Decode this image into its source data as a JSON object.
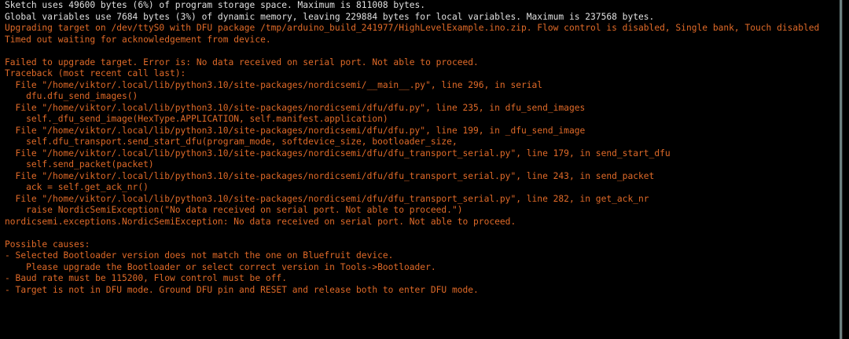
{
  "console": {
    "lines": [
      {
        "text": "Sketch uses 49600 bytes (6%) of program storage space. Maximum is 811008 bytes.",
        "style": "normal"
      },
      {
        "text": "Global variables use 7684 bytes (3%) of dynamic memory, leaving 229884 bytes for local variables. Maximum is 237568 bytes.",
        "style": "normal"
      },
      {
        "text": "Upgrading target on /dev/ttyS0 with DFU package /tmp/arduino_build_241977/HighLevelExample.ino.zip. Flow control is disabled, Single bank, Touch disabled",
        "style": "err"
      },
      {
        "text": "Timed out waiting for acknowledgement from device.",
        "style": "err"
      },
      {
        "text": "",
        "style": "blank"
      },
      {
        "text": "Failed to upgrade target. Error is: No data received on serial port. Not able to proceed.",
        "style": "err"
      },
      {
        "text": "Traceback (most recent call last):",
        "style": "err"
      },
      {
        "text": "  File \"/home/viktor/.local/lib/python3.10/site-packages/nordicsemi/__main__.py\", line 296, in serial",
        "style": "err"
      },
      {
        "text": "    dfu.dfu_send_images()",
        "style": "err"
      },
      {
        "text": "  File \"/home/viktor/.local/lib/python3.10/site-packages/nordicsemi/dfu/dfu.py\", line 235, in dfu_send_images",
        "style": "err"
      },
      {
        "text": "    self._dfu_send_image(HexType.APPLICATION, self.manifest.application)",
        "style": "err"
      },
      {
        "text": "  File \"/home/viktor/.local/lib/python3.10/site-packages/nordicsemi/dfu/dfu.py\", line 199, in _dfu_send_image",
        "style": "err"
      },
      {
        "text": "    self.dfu_transport.send_start_dfu(program_mode, softdevice_size, bootloader_size,",
        "style": "err"
      },
      {
        "text": "  File \"/home/viktor/.local/lib/python3.10/site-packages/nordicsemi/dfu/dfu_transport_serial.py\", line 179, in send_start_dfu",
        "style": "err"
      },
      {
        "text": "    self.send_packet(packet)",
        "style": "err"
      },
      {
        "text": "  File \"/home/viktor/.local/lib/python3.10/site-packages/nordicsemi/dfu/dfu_transport_serial.py\", line 243, in send_packet",
        "style": "err"
      },
      {
        "text": "    ack = self.get_ack_nr()",
        "style": "err"
      },
      {
        "text": "  File \"/home/viktor/.local/lib/python3.10/site-packages/nordicsemi/dfu/dfu_transport_serial.py\", line 282, in get_ack_nr",
        "style": "err"
      },
      {
        "text": "    raise NordicSemiException(\"No data received on serial port. Not able to proceed.\")",
        "style": "err"
      },
      {
        "text": "nordicsemi.exceptions.NordicSemiException: No data received on serial port. Not able to proceed.",
        "style": "err"
      },
      {
        "text": "",
        "style": "blank"
      },
      {
        "text": "Possible causes:",
        "style": "err"
      },
      {
        "text": "- Selected Bootloader version does not match the one on Bluefruit device.",
        "style": "err"
      },
      {
        "text": "    Please upgrade the Bootloader or select correct version in Tools->Bootloader.",
        "style": "err"
      },
      {
        "text": "- Baud rate must be 115200, Flow control must be off.",
        "style": "err"
      },
      {
        "text": "- Target is not in DFU mode. Ground DFU pin and RESET and release both to enter DFU mode.",
        "style": "err"
      }
    ]
  },
  "colors": {
    "background": "#000000",
    "normal_text": "#e0e0e0",
    "error_text": "#e06a28",
    "scroll_thumb": "#6c8080"
  }
}
